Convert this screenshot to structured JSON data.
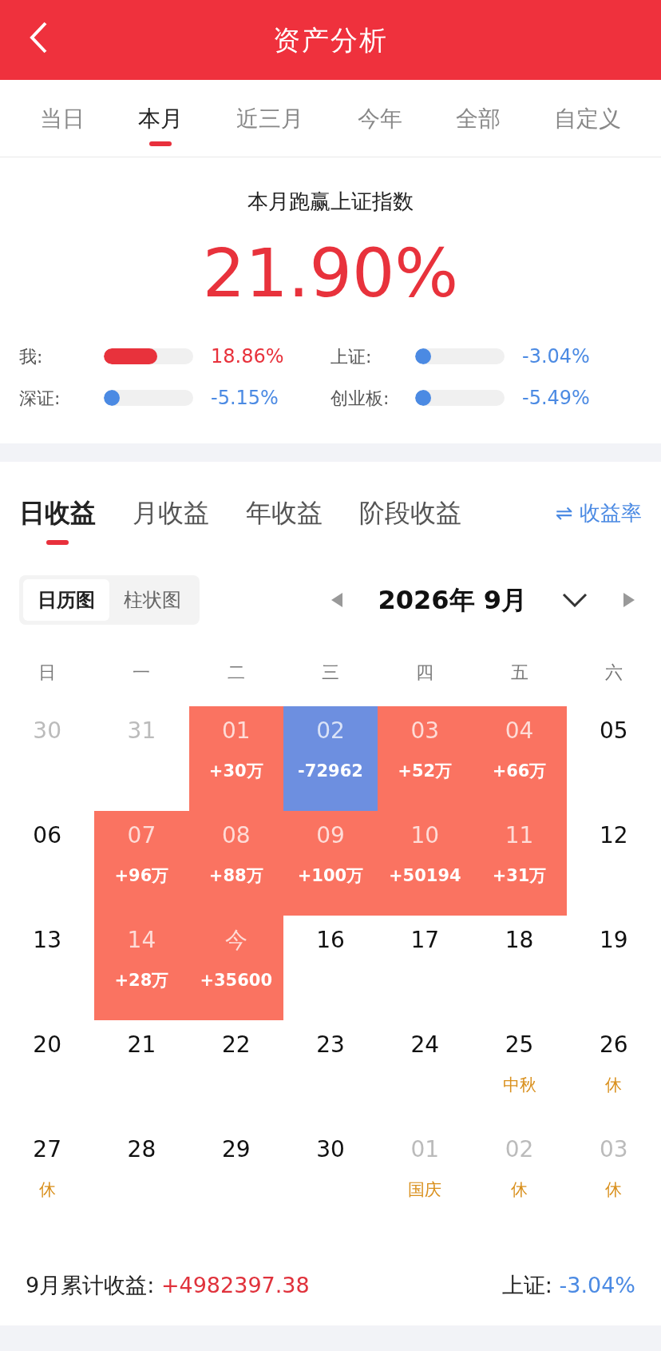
{
  "header": {
    "title": "资产分析"
  },
  "period_tabs": [
    {
      "label": "当日",
      "selected": false
    },
    {
      "label": "本月",
      "selected": true
    },
    {
      "label": "近三月",
      "selected": false
    },
    {
      "label": "今年",
      "selected": false
    },
    {
      "label": "全部",
      "selected": false
    },
    {
      "label": "自定义",
      "selected": false
    }
  ],
  "summary": {
    "title": "本月跑赢上证指数",
    "value": "21.90%",
    "comparisons": [
      {
        "label": "我:",
        "level": 0.6,
        "color": "#e8323c",
        "reading": "18.86%"
      },
      {
        "label": "上证:",
        "level": 0.1,
        "color": "#4b8ae3",
        "reading": "-3.04%"
      },
      {
        "label": "深证:",
        "level": 0.16,
        "color": "#4b8ae3",
        "reading": "-5.15%"
      },
      {
        "label": "创业板:",
        "level": 0.16,
        "color": "#4b8ae3",
        "reading": "-5.49%"
      }
    ]
  },
  "earnings_tabs": [
    {
      "label": "日收益",
      "selected": true
    },
    {
      "label": "月收益",
      "selected": false
    },
    {
      "label": "年收益",
      "selected": false
    },
    {
      "label": "阶段收益",
      "selected": false
    }
  ],
  "rate_toggle": {
    "icon": "⇌",
    "label": "收益率"
  },
  "view_toggle": [
    {
      "label": "日历图",
      "selected": true
    },
    {
      "label": "柱状图",
      "selected": false
    }
  ],
  "month_picker": {
    "label": "2026年 9月"
  },
  "weekdays": [
    "日",
    "一",
    "二",
    "三",
    "四",
    "五",
    "六"
  ],
  "days": [
    {
      "day": "30",
      "kind": "muted"
    },
    {
      "day": "31",
      "kind": "muted"
    },
    {
      "day": "01",
      "kind": "gain",
      "amount": "+30万"
    },
    {
      "day": "02",
      "kind": "loss",
      "amount": "-72962"
    },
    {
      "day": "03",
      "kind": "gain",
      "amount": "+52万"
    },
    {
      "day": "04",
      "kind": "gain",
      "amount": "+66万"
    },
    {
      "day": "05",
      "kind": "plain"
    },
    {
      "day": "06",
      "kind": "plain"
    },
    {
      "day": "07",
      "kind": "gain",
      "amount": "+96万"
    },
    {
      "day": "08",
      "kind": "gain",
      "amount": "+88万"
    },
    {
      "day": "09",
      "kind": "gain",
      "amount": "+100万"
    },
    {
      "day": "10",
      "kind": "gain",
      "amount": "+50194"
    },
    {
      "day": "11",
      "kind": "gain",
      "amount": "+31万"
    },
    {
      "day": "12",
      "kind": "plain"
    },
    {
      "day": "13",
      "kind": "plain"
    },
    {
      "day": "14",
      "kind": "gain",
      "amount": "+28万"
    },
    {
      "day": "今",
      "kind": "gain",
      "amount": "+35600"
    },
    {
      "day": "16",
      "kind": "plain"
    },
    {
      "day": "17",
      "kind": "plain"
    },
    {
      "day": "18",
      "kind": "plain"
    },
    {
      "day": "19",
      "kind": "plain"
    },
    {
      "day": "20",
      "kind": "plain"
    },
    {
      "day": "21",
      "kind": "plain"
    },
    {
      "day": "22",
      "kind": "plain"
    },
    {
      "day": "23",
      "kind": "plain"
    },
    {
      "day": "24",
      "kind": "plain"
    },
    {
      "day": "25",
      "kind": "plain",
      "note": "中秋"
    },
    {
      "day": "26",
      "kind": "plain",
      "note": "休"
    },
    {
      "day": "27",
      "kind": "plain",
      "note": "休"
    },
    {
      "day": "28",
      "kind": "plain"
    },
    {
      "day": "29",
      "kind": "plain"
    },
    {
      "day": "30",
      "kind": "plain"
    },
    {
      "day": "01",
      "kind": "muted",
      "note": "国庆"
    },
    {
      "day": "02",
      "kind": "muted",
      "note": "休"
    },
    {
      "day": "03",
      "kind": "muted",
      "note": "休"
    }
  ],
  "footer": {
    "label": "9月累计收益:",
    "value": "+4982397.38",
    "index_label": "上证:",
    "index_value": "-3.04%"
  }
}
